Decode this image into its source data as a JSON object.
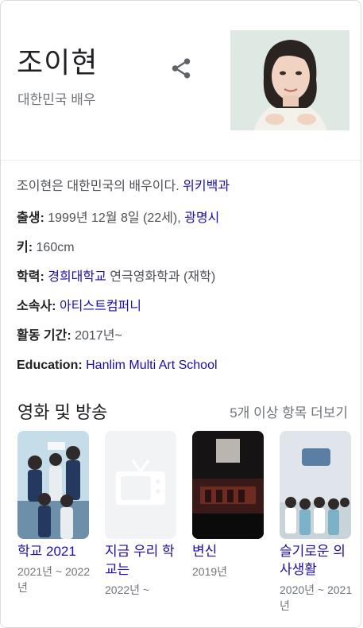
{
  "profile": {
    "name": "조이현",
    "subtitle": "대한민국 배우",
    "description_text": "조이현은 대한민국의 배우이다.",
    "description_source": "위키백과"
  },
  "facts": [
    {
      "label": "출생:",
      "text": "1999년 12월 8일 (22세),",
      "link": "광명시",
      "after": ""
    },
    {
      "label": "키:",
      "text": "160cm",
      "link": "",
      "after": ""
    },
    {
      "label": "학력:",
      "text": "",
      "link": "경희대학교",
      "after": "연극영화학과 (재학)"
    },
    {
      "label": "소속사:",
      "text": "",
      "link": "아티스트컴퍼니",
      "after": ""
    },
    {
      "label": "활동 기간:",
      "text": "2017년~",
      "link": "",
      "after": ""
    },
    {
      "label": "Education:",
      "text": "",
      "link": "Hanlim Multi Art School",
      "after": ""
    }
  ],
  "media": {
    "title": "영화 및 방송",
    "more_label": "5개 이상 항목 더보기",
    "items": [
      {
        "title": "학교 2021",
        "years": "2021년 ~ 2022년"
      },
      {
        "title": "지금 우리 학교는",
        "years": "2022년 ~"
      },
      {
        "title": "변신",
        "years": "2019년"
      },
      {
        "title": "슬기로운 의사생활",
        "years": "2020년 ~ 2021년"
      }
    ]
  },
  "icons": {
    "share": "share-icon",
    "placeholder": "tv-icon"
  },
  "colors": {
    "link": "#1a0dab",
    "muted": "#70757a",
    "text": "#202124"
  }
}
